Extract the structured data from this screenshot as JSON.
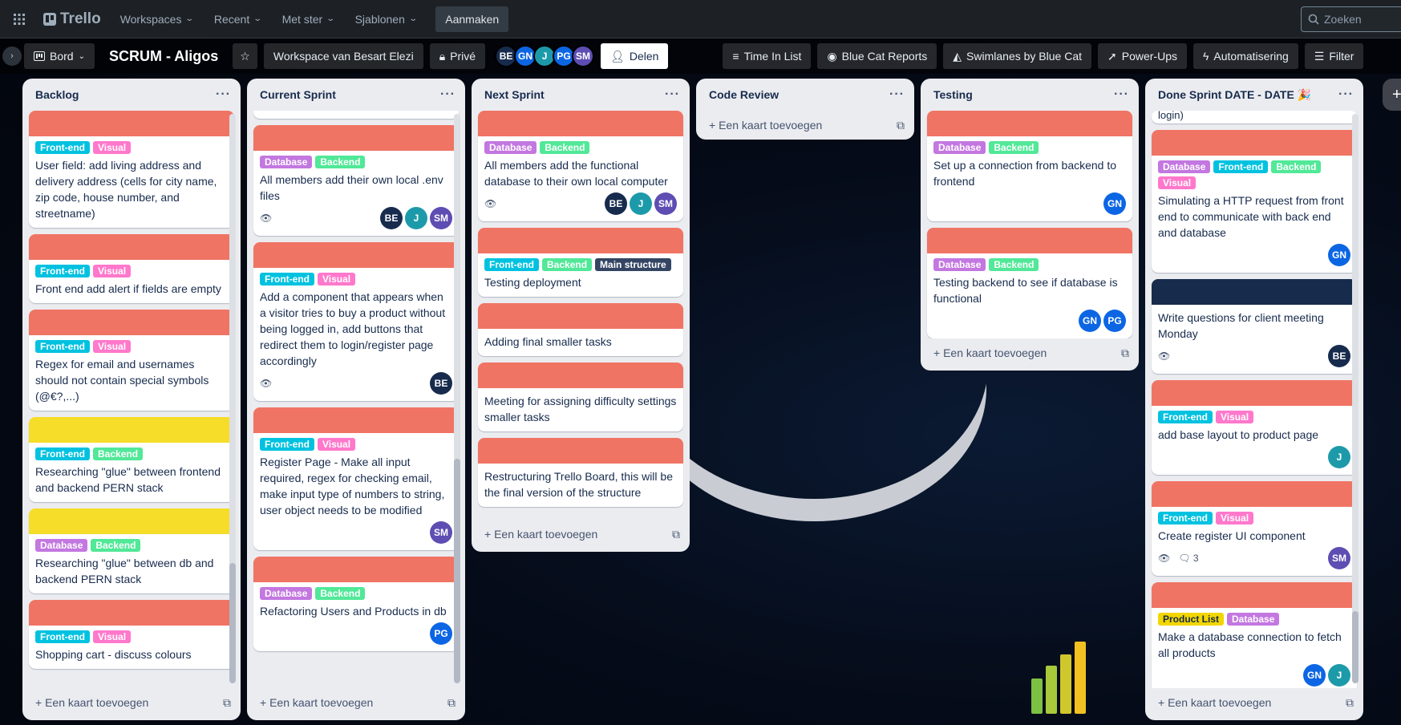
{
  "topnav": {
    "brand": "Trello",
    "menus": [
      "Workspaces",
      "Recent",
      "Met ster",
      "Sjablonen"
    ],
    "create_label": "Aanmaken",
    "search_placeholder": "Zoeken"
  },
  "boardbar": {
    "view_label": "Bord",
    "title": "SCRUM - Aligos",
    "workspace_label": "Workspace van Besart Elezi",
    "visibility_label": "Privé",
    "members": [
      "BE",
      "GN",
      "J",
      "PG",
      "SM"
    ],
    "share_label": "Delen",
    "powerups": [
      "Time In List",
      "Blue Cat Reports",
      "Swimlanes by Blue Cat",
      "Power-Ups",
      "Automatisering",
      "Filter"
    ]
  },
  "label_colors": {
    "Front-end": "#00c2e0",
    "Visual": "#ff78cb",
    "Backend": "#51e898",
    "Database": "#c377e0",
    "Main structure": "#344563",
    "Product List": "#f2d600"
  },
  "cover_colors": {
    "red": "#f07464",
    "yellow": "#f5dd29",
    "navy": "#172b4d"
  },
  "add_card_label": "Een kaart toevoegen",
  "lists": [
    {
      "name": "Backlog",
      "cards": [
        {
          "cover": "red",
          "labels": [
            "Front-end",
            "Visual"
          ],
          "title": "User field: add living address and delivery address (cells for city name, zip code, house number, and streetname)",
          "watch": false,
          "comments": "",
          "members": []
        },
        {
          "cover": "red",
          "labels": [
            "Front-end",
            "Visual"
          ],
          "title": "Front end add alert if fields are empty",
          "watch": false,
          "comments": "",
          "members": []
        },
        {
          "cover": "red",
          "labels": [
            "Front-end",
            "Visual"
          ],
          "title": "Regex for email and usernames should not contain special symbols (@€?,...)",
          "watch": false,
          "comments": "",
          "members": []
        },
        {
          "cover": "yellow",
          "labels": [
            "Front-end",
            "Backend"
          ],
          "title": "Researching \"glue\" between frontend and backend PERN stack",
          "watch": false,
          "comments": "",
          "members": []
        },
        {
          "cover": "yellow",
          "labels": [
            "Database",
            "Backend"
          ],
          "title": "Researching \"glue\" between db and backend PERN stack",
          "watch": false,
          "comments": "",
          "members": []
        },
        {
          "cover": "red",
          "labels": [
            "Front-end",
            "Visual"
          ],
          "title": "Shopping cart - discuss colours",
          "watch": false,
          "comments": "",
          "members": []
        }
      ]
    },
    {
      "name": "Current Sprint",
      "cards": [
        {
          "cover": "red",
          "labels": [
            "Database",
            "Backend"
          ],
          "title": "All members add their own local .env files",
          "watch": true,
          "comments": "",
          "members": [
            "BE",
            "J",
            "SM"
          ]
        },
        {
          "cover": "red",
          "labels": [
            "Front-end",
            "Visual"
          ],
          "title": "Add a component that appears when a visitor tries to buy a product without being logged in, add buttons that redirect them to login/register page accordingly",
          "watch": true,
          "comments": "",
          "members": [
            "BE"
          ]
        },
        {
          "cover": "red",
          "labels": [
            "Front-end",
            "Visual"
          ],
          "title": "Register Page - Make all input required, regex for checking email, make input type of numbers to string, user object needs to be modified",
          "watch": false,
          "comments": "",
          "members": [
            "SM"
          ]
        },
        {
          "cover": "red",
          "labels": [
            "Database",
            "Backend"
          ],
          "title": "Refactoring Users and Products in db",
          "watch": false,
          "comments": "",
          "members": [
            "PG"
          ]
        }
      ]
    },
    {
      "name": "Next Sprint",
      "cards": [
        {
          "cover": "red",
          "labels": [
            "Database",
            "Backend"
          ],
          "title": "All members add the functional database to their own local computer",
          "watch": true,
          "comments": "",
          "members": [
            "BE",
            "J",
            "SM"
          ]
        },
        {
          "cover": "red",
          "labels": [
            "Front-end",
            "Backend",
            "Main structure"
          ],
          "title": "Testing deployment",
          "watch": false,
          "comments": "",
          "members": []
        },
        {
          "cover": "red",
          "labels": [],
          "title": "Adding final smaller tasks",
          "watch": false,
          "comments": "",
          "members": []
        },
        {
          "cover": "red",
          "labels": [],
          "title": "Meeting for assigning difficulty settings smaller tasks",
          "watch": false,
          "comments": "",
          "members": []
        },
        {
          "cover": "red",
          "labels": [],
          "title": "Restructuring Trello Board, this will be the final version of the structure",
          "watch": false,
          "comments": "",
          "members": []
        }
      ]
    },
    {
      "name": "Code Review",
      "cards": []
    },
    {
      "name": "Testing",
      "cards": [
        {
          "cover": "red",
          "labels": [
            "Database",
            "Backend"
          ],
          "title": "Set up a connection from backend to frontend",
          "watch": false,
          "comments": "",
          "members": [
            "GN"
          ]
        },
        {
          "cover": "red",
          "labels": [
            "Database",
            "Backend"
          ],
          "title": "Testing backend to see if database is functional",
          "watch": false,
          "comments": "",
          "members": [
            "GN",
            "PG"
          ]
        }
      ]
    },
    {
      "name": "Done Sprint DATE - DATE 🎉",
      "cards": [
        {
          "cover": "red",
          "labels": [
            "Database",
            "Front-end",
            "Backend",
            "Visual"
          ],
          "title": "Simulating a HTTP request from front end to communicate with back end and database",
          "watch": false,
          "comments": "",
          "members": [
            "GN"
          ]
        },
        {
          "cover": "navy",
          "labels": [],
          "title": "Write questions for client meeting Monday",
          "watch": true,
          "comments": "",
          "members": [
            "BE"
          ]
        },
        {
          "cover": "red",
          "labels": [
            "Front-end",
            "Visual"
          ],
          "title": "add base layout to product page",
          "watch": false,
          "comments": "",
          "members": [
            "J"
          ]
        },
        {
          "cover": "red",
          "labels": [
            "Front-end",
            "Visual"
          ],
          "title": "Create register UI component",
          "watch": true,
          "comments": "3",
          "members": [
            "SM"
          ]
        },
        {
          "cover": "red",
          "labels": [
            "Product List",
            "Database"
          ],
          "title": "Make a database connection to fetch all products",
          "watch": false,
          "comments": "",
          "members": [
            "GN",
            "J"
          ]
        }
      ]
    }
  ],
  "partial_card_text": "login)"
}
